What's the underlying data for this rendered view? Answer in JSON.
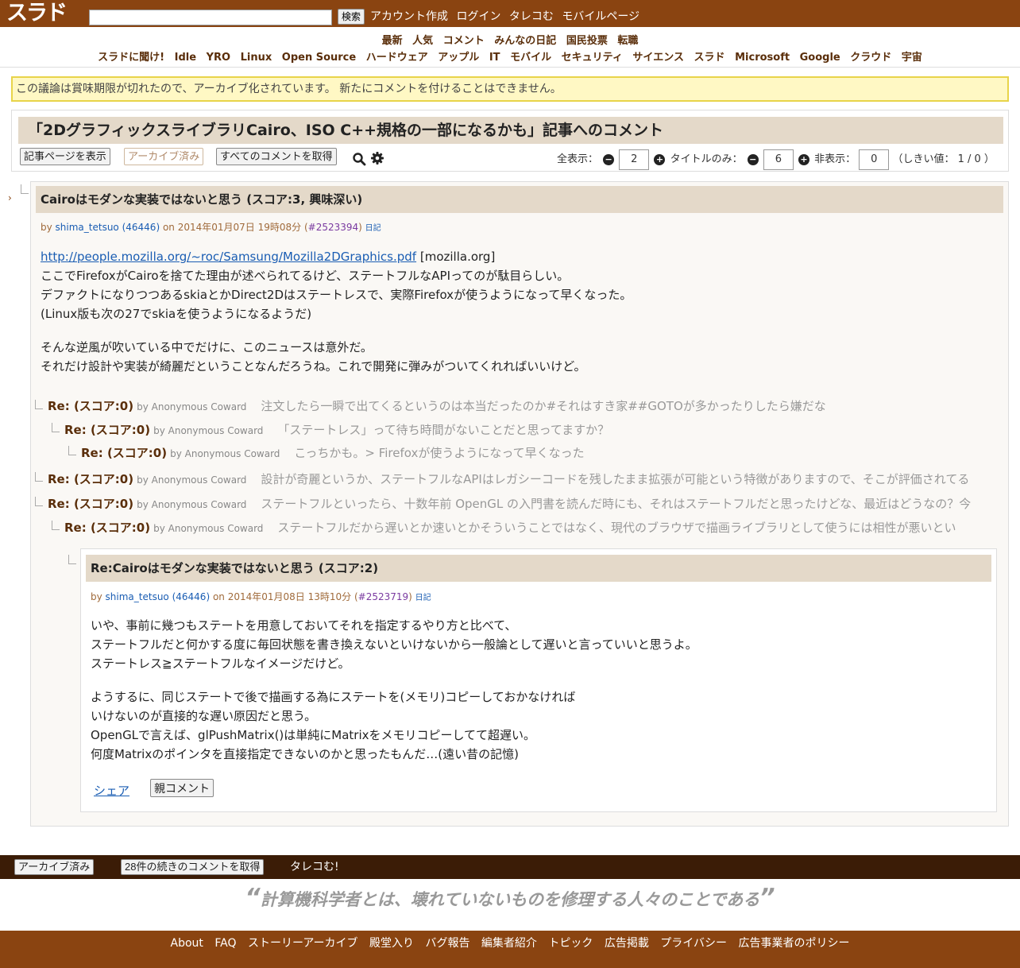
{
  "header": {
    "logo": "スラド",
    "search_placeholder": "",
    "search_button": "検索",
    "links": [
      "アカウント作成",
      "ログイン",
      "タレコむ",
      "モバイルページ"
    ]
  },
  "nav": {
    "row1": [
      "最新",
      "人気",
      "コメント",
      "みんなの日記",
      "国民投票",
      "転職"
    ],
    "row2": [
      "スラドに聞け!",
      "Idle",
      "YRO",
      "Linux",
      "Open Source",
      "ハードウェア",
      "アップル",
      "IT",
      "モバイル",
      "セキュリティ",
      "サイエンス",
      "スラド",
      "Microsoft",
      "Google",
      "クラウド",
      "宇宙"
    ]
  },
  "notice": "この議論は賞味期限が切れたので、アーカイブ化されています。 新たにコメントを付けることはできません。",
  "article": {
    "title": "「2Dグラフィックスライブラリ​Cairo、ISO C++規格の一部になるかも」記事へのコメント",
    "view_article": "記事ページを表示",
    "archived": "アーカイブ済み",
    "get_all": "すべてのコメントを取得"
  },
  "thresholds": {
    "full_label": "全表示：",
    "full_value": "2",
    "title_label": "タイトルのみ：",
    "title_value": "6",
    "hidden_label": "非表示：",
    "hidden_value": "0",
    "note": "（しきい値： 1 / 0 ）"
  },
  "comment1": {
    "title": "Cairoはモダンな実装ではないと思う (スコア:3, 興味深い)",
    "by": "by",
    "user": "shima_tetsuo (46446)",
    "on": "on 2014年01月07日 19時08分 (",
    "cid": "#2523394",
    "close": ")",
    "diary": "日記",
    "link": "http://people.mozilla.org/~roc/Samsung/Mozilla2DGraphics.pdf",
    "link_domain": "[mozilla.org]",
    "lines": [
      "ここでFirefoxがCairoを捨てた理由が述べられてるけど、ステートフルなAPIってのが駄目らしい。",
      "デファクトになりつつあるskiaとかDirect2Dはステートレスで、実際Firefoxが使うようになって早くなった。",
      "(Linux版も次の27でskiaを使うようになるようだ)",
      "そんな逆風が吹いている中でだけに、このニュースは意外だ。",
      "それだけ設計や実装が綺麗だということなんだろうね。これで開発に弾みがついてくれればいいけど。"
    ]
  },
  "replies": [
    {
      "title": "Re: (スコア:0)",
      "by": "by Anonymous Coward",
      "snippet": "注文したら一瞬で出てくるというのは本当だったのか#それはすき家##GOTOが多かったりしたら嫌だな"
    },
    {
      "title": "Re: (スコア:0)",
      "by": "by Anonymous Coward",
      "snippet": "「ステートレス」って待ち時間がないことだと思ってますか？"
    },
    {
      "title": "Re: (スコア:0)",
      "by": "by Anonymous Coward",
      "snippet": "こっちかも。> Firefoxが使うようになって早くなった"
    },
    {
      "title": "Re: (スコア:0)",
      "by": "by Anonymous Coward",
      "snippet": "設計が奇麗というか、ステートフルなAPIはレガシーコードを残したまま拡張が可能という特徴がありますので、そこが評価されてる"
    },
    {
      "title": "Re: (スコア:0)",
      "by": "by Anonymous Coward",
      "snippet": "ステートフルといったら、十数年前 OpenGL の入門書を読んだ時にも、それはステートフルだと思ったけどな、最近はどうなの？今"
    },
    {
      "title": "Re: (スコア:0)",
      "by": "by Anonymous Coward",
      "snippet": "ステートフルだから遅いとか速いとかそういうことではなく、現代のブラウザで描画ライブラリとして使うには相性が悪いとい"
    }
  ],
  "comment2": {
    "title": "Re:Cairoはモダンな実装ではないと思う (スコア:2)",
    "by": "by",
    "user": "shima_tetsuo (46446)",
    "on": "on 2014年01月08日 13時10分 (",
    "cid": "#2523719",
    "close": ")",
    "diary": "日記",
    "lines": [
      "いや、事前に幾つもステートを用意しておいてそれを指定するやり方と比べて、",
      "ステートフルだと何かする度に毎回状態を書き換えないといけないから一般論として遅いと言っていいと思うよ。",
      "ステートレス≧ステートフルなイメージだけど。",
      "ようするに、同じステートで後で描画する為にステートを(メモリ)コピーしておかなければ",
      "いけないのが直接的な遅い原因だと思う。",
      "OpenGLで言えば、glPushMatrix()は単純にMatrixをメモリコピーしてて超遅い。",
      "何度Matrixのポインタを直接指定できないのかと思ったもんだ…(遠い昔の記憶)"
    ],
    "share": "シェア",
    "parent": "親コメント"
  },
  "bottombar": {
    "archived": "アーカイブ済み",
    "more": "28件の続きのコメントを取得",
    "tarekomu": "タレコむ!"
  },
  "quote": {
    "open": "“",
    "text": "計算機科学者とは、壊れていないものを修理する人々のことである",
    "close": "”"
  },
  "footer": [
    "About",
    "FAQ",
    "ストーリーアーカイブ",
    "殿堂入り",
    "バグ報告",
    "編集者紹介",
    "トピック",
    "広告掲載",
    "プライバシー",
    "広告事業者のポリシー"
  ]
}
